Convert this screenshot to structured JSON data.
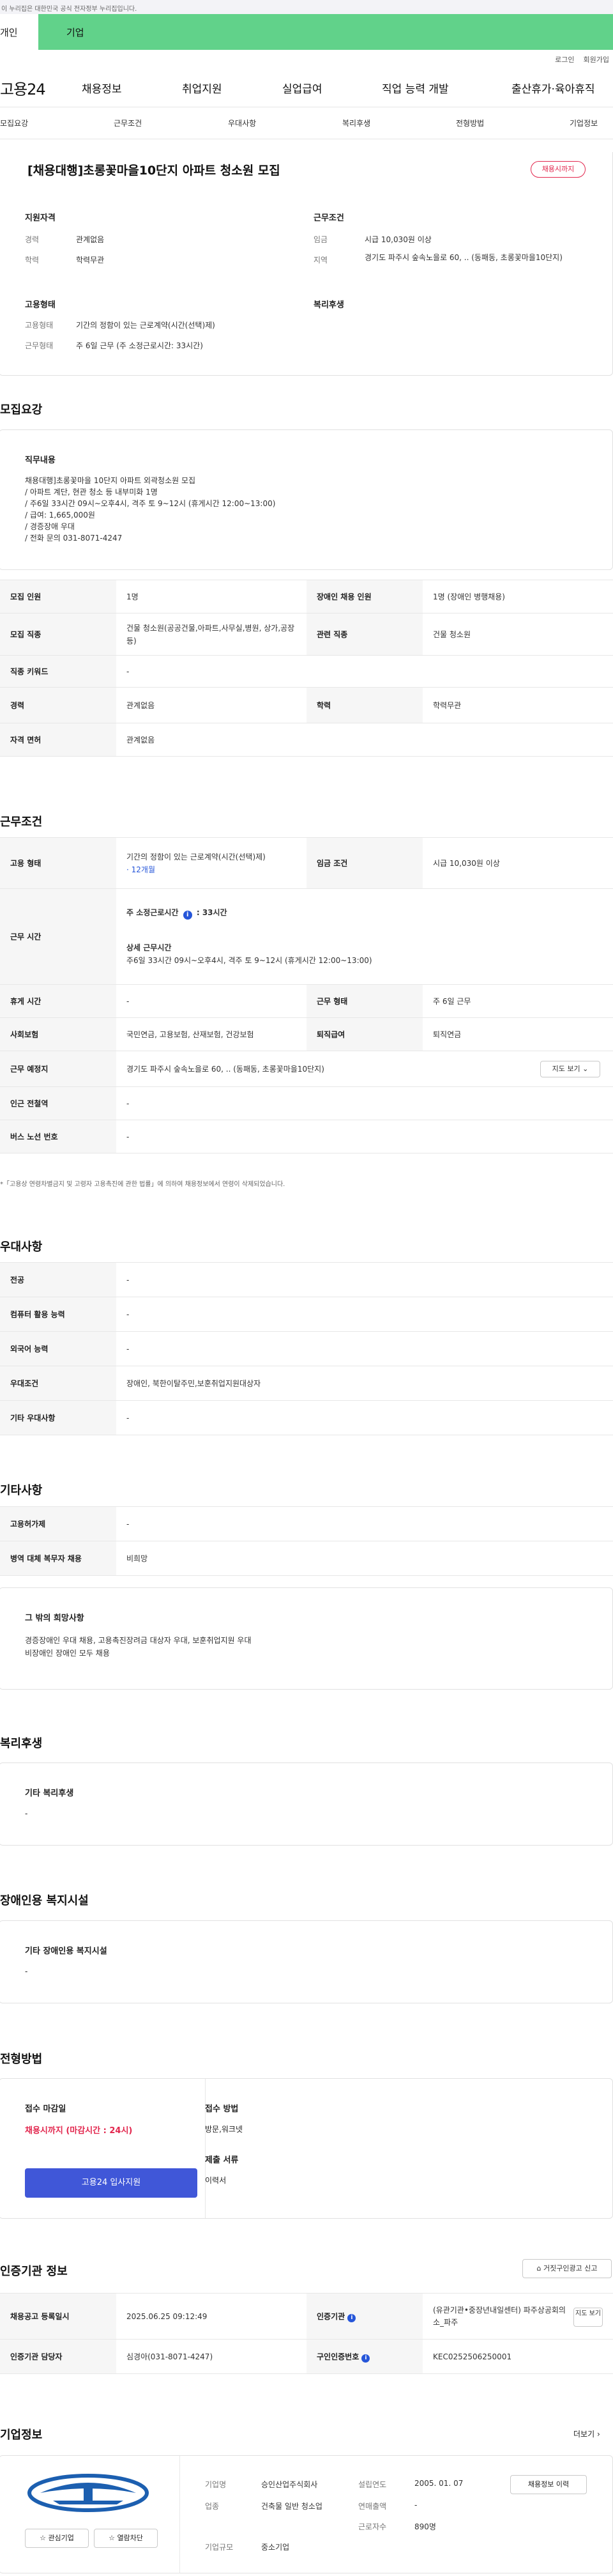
{
  "top_notice": "이 누리집은 대한민국 공식 전자정부 누리집입니다.",
  "top_tabs": [
    "개인",
    "기업"
  ],
  "util": [
    "로그인",
    "회원가입"
  ],
  "gnb": {
    "logo": "고용24",
    "menu": [
      "채용정보",
      "취업지원",
      "실업급여",
      "직업 능력 개발",
      "출산휴가·육아휴직"
    ]
  },
  "subnav": [
    "모집요강",
    "근무조건",
    "우대사항",
    "복리후생",
    "전형방법",
    "기업정보"
  ],
  "summary": {
    "title": "[채용대행]초롱꽃마을10단지 아파트 청소원 모집",
    "badge": "채용시까지",
    "qual_title": "지원자격",
    "cond_title": "근무조건",
    "career_label": "경력",
    "career": "관계없음",
    "edu_label": "학력",
    "edu": "학력무관",
    "wage_label": "임금",
    "wage": "시급 10,030원 이상",
    "region_label": "지역",
    "region": "경기도 파주시 숲속노을로 60, .. (동패동, 초롱꽃마을10단지)",
    "emp_title": "고용형태",
    "welfare_title": "복리후생",
    "emptype_label": "고용형태",
    "emptype": "기간의 정함이 있는 근로계약(시간(선택)제)",
    "worktime_label": "근무형태",
    "worktime": "주 6일 근무 (주 소정근로시간: 33시간)"
  },
  "recruit": {
    "title": "모집요강",
    "job_title": "직무내용",
    "job_lines": [
      "채용대행]초롱꽃마을 10단지 아파트 외곽청소원 모집",
      "/ 아파트 계단, 현관 청소 등 내부미화 1명",
      "/ 주6일 33시간  09시~오후4시, 격주 토 9~12시   (휴게시간 12:00~13:00)",
      "/ 급여: 1,665,000원",
      "/ 경증장애 우대",
      "/ 전화 문의 031-8071-4247"
    ],
    "count_label": "모집 인원",
    "count": "1명",
    "disabled_label": "장애인 채용 인원",
    "disabled": "1명 (장애인 병행채용)",
    "jobtype_label": "모집 직종",
    "jobtype": "건물 청소원(공공건물,아파트,사무실,병원, 상가,공장 등)",
    "related_label": "관련 직종",
    "related": "건물 청소원",
    "keyword_label": "직종 키워드",
    "keyword": "-",
    "career_label": "경력",
    "career": "관계없음",
    "edu_label": "학력",
    "edu": "학력무관",
    "license_label": "자격 면허",
    "license": "관계없음"
  },
  "conditions": {
    "title": "근무조건",
    "emptype_label": "고용 형태",
    "emptype": "기간의 정함이 있는 근로계약(시간(선택)제)",
    "emptype_period": "· 12개월",
    "wage_label": "임금 조건",
    "wage": "시급 10,030원 이상",
    "worktime_label": "근무 시간",
    "hours_label": "주 소정근로시간",
    "hours": ": 33시간",
    "detail_label": "상세 근무시간",
    "detail": "주6일 33시간  09시~오후4시, 격주 토 9~12시   (휴게시간 12:00~13:00)",
    "rest_label": "휴게 시간",
    "rest": "-",
    "form_label": "근무 형태",
    "form": "주 6일 근무",
    "insurance_label": "사회보험",
    "insurance": "국민연금, 고용보험, 산재보험, 건강보험",
    "severance_label": "퇴직급여",
    "severance": "퇴직연금",
    "place_label": "근무 예정지",
    "place": "경기도 파주시 숲속노을로 60, .. (동패동, 초롱꽃마을10단지)",
    "map_btn": "지도 보기",
    "subway_label": "인근 전철역",
    "subway": "-",
    "bus_label": "버스 노선 번호",
    "bus": "-",
    "note": "*「고용상 연령차별금지 및 고령자 고용촉진에 관한 법률」에 의하여 채용정보에서 연령이 삭제되었습니다."
  },
  "preference": {
    "title": "우대사항",
    "major_label": "전공",
    "major": "-",
    "pc_label": "컴퓨터 활용 능력",
    "pc": "-",
    "lang_label": "외국어 능력",
    "lang": "-",
    "cond_label": "우대조건",
    "cond": "장애인, 북한이탈주민,보훈취업지원대상자",
    "etc_label": "기타 우대사항",
    "etc": "-"
  },
  "etc": {
    "title": "기타사항",
    "hire_label": "고용허가제",
    "hire": "-",
    "military_label": "병역 대체 복무자 채용",
    "military": "비희망",
    "other_title": "그 밖의 희망사항",
    "other_lines": [
      "경증장애인 우대 채용, 고용촉진장려금 대상자 우대, 보훈취업지원 우대",
      "비장애인 장애인 모두 채용"
    ]
  },
  "welfare": {
    "title": "복리후생",
    "box_title": "기타 복리후생",
    "value": "-"
  },
  "disabled_facility": {
    "title": "장애인용 복지시설",
    "box_title": "기타 장애인용 복지시설",
    "value": "-"
  },
  "selection": {
    "title": "전형방법",
    "deadline_title": "접수 마감일",
    "deadline": "채용시까지 (마감시간 : 24시)",
    "method_title": "접수 방법",
    "method": "방문,워크넷",
    "docs_title": "제출 서류",
    "docs": "이력서",
    "apply_btn": "고용24 입사지원"
  },
  "cert": {
    "title": "인증기관 정보",
    "report_btn": "거짓구인광고 신고",
    "reg_label": "채용공고 등록일시",
    "reg": "2025.06.25 09:12:49",
    "agency_label": "인증기관",
    "agency": "(유관기관•중장년내일센터) 파주상공회의소_파주",
    "map_btn": "지도 보기",
    "manager_label": "인증기관 담당자",
    "manager": "심경아(031-8071-4247)",
    "jobno_label": "구인인증번호",
    "jobno": "KEC0252506250001"
  },
  "company": {
    "title": "기업정보",
    "more": "더보기",
    "name_label": "기업명",
    "name": "승인산업주식회사",
    "industry_label": "업종",
    "industry": "건축물 일반 청소업",
    "size_label": "기업규모",
    "size": "중소기업",
    "founded_label": "설립연도",
    "founded": "2005. 01. 07",
    "sales_label": "연매출액",
    "sales": "-",
    "staff_label": "근로자수",
    "staff": "890명",
    "fav_btn": "관심기업",
    "block_btn": "열람차단",
    "jobs_btn": "채용정보 이력"
  },
  "colors": {
    "green_tab": "#61d28a",
    "red": "#e2264d",
    "blue": "#2656d9",
    "apply_btn": "#4057d8",
    "logo_blue": "#1c5fb0"
  }
}
